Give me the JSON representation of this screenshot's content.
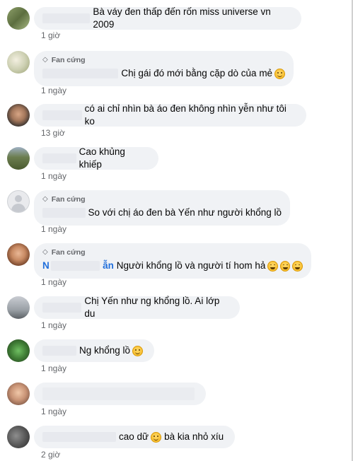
{
  "badge_label": "Fan cứng",
  "comments": [
    {
      "text": "Bà váy đen thấp đến rốn miss universe vn 2009",
      "time": "1 giờ"
    },
    {
      "text": "Chị gái đó mới bằng cặp dò của mẻ",
      "time": "1 ngày",
      "badge": true
    },
    {
      "text": "có ai chỉ nhìn bà áo đen không nhìn yễn như tôi ko",
      "time": "13 giờ"
    },
    {
      "text": "Cao khủng khiếp",
      "time": "1 ngày"
    },
    {
      "text": "So với chị áo đen bà Yến như người khổng lồ",
      "time": "1 ngày",
      "badge": true
    },
    {
      "name_start": "N",
      "name_end": "ẫn",
      "text": "Người khổng lồ và người tí hom hả",
      "time": "1 ngày",
      "badge": true
    },
    {
      "text": "Chị Yến như ng khổng lồ. Ai lớp du",
      "time": "1 ngày"
    },
    {
      "text": "Ng khổng lồ",
      "time": "1 ngày"
    },
    {
      "text": "",
      "time": "1 ngày"
    },
    {
      "text_a": "cao dữ",
      "text_b": "bà kia nhỏ xíu",
      "time": "2 giờ"
    }
  ],
  "icons": [
    "fan-badge-gem-icon",
    "smile-emoji-icon",
    "laugh-emoji-icon",
    "grin-emoji-icon"
  ]
}
